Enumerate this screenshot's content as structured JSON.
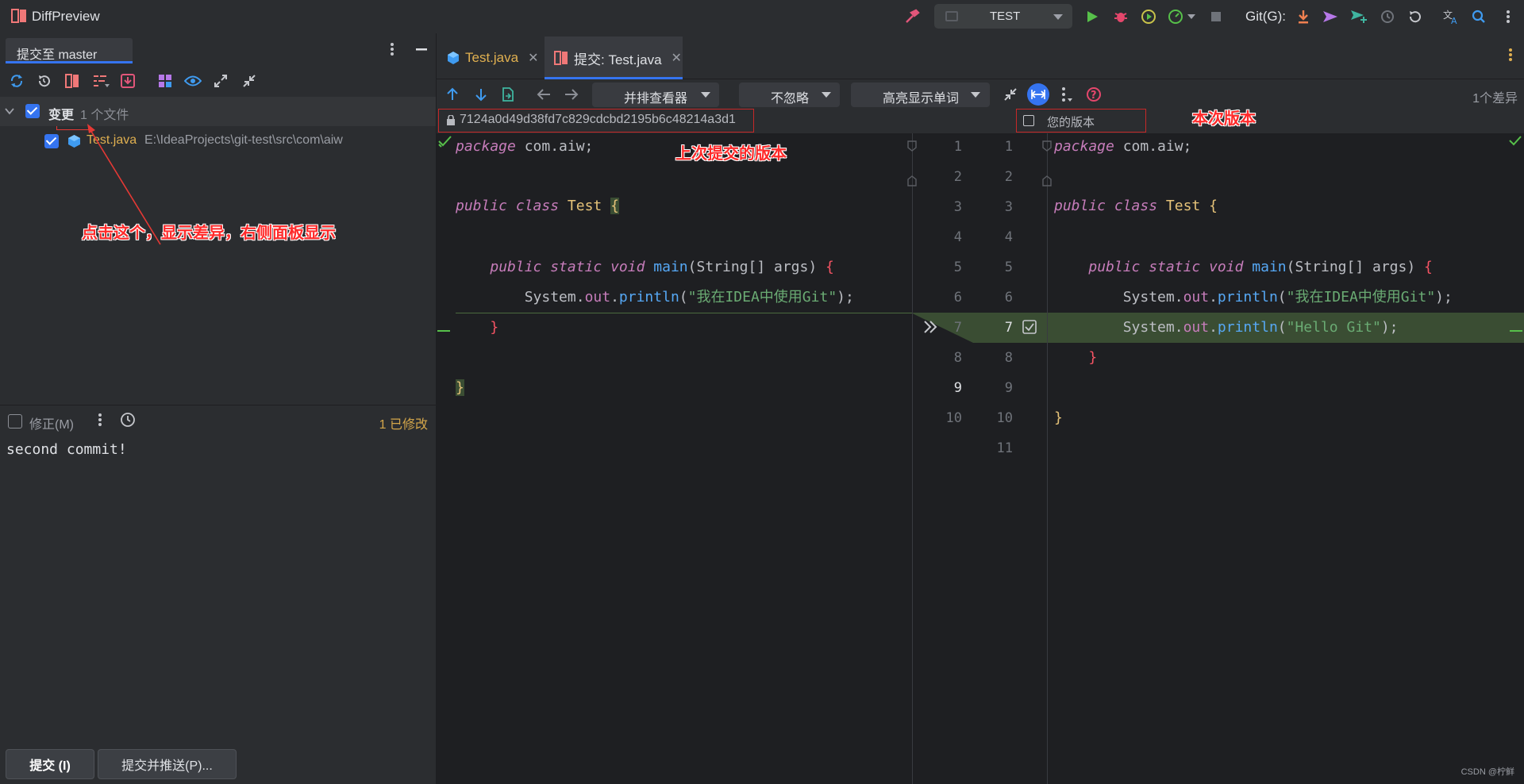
{
  "window": {
    "app_title": "DiffPreview",
    "run_config": "TEST",
    "git_label": "Git(G):"
  },
  "left_panel": {
    "tab_label": "提交至 master",
    "changes_label": "变更",
    "changes_count": "1 个文件",
    "file": {
      "name": "Test.java",
      "path": "E:\\IdeaProjects\\git-test\\src\\com\\aiw"
    },
    "amend_label": "修正(M)",
    "modified_count": "1 已修改",
    "commit_message": "second commit!",
    "commit_button": "提交 (I)",
    "commit_push_button": "提交并推送(P)..."
  },
  "editor_tabs": [
    {
      "label": "Test.java"
    },
    {
      "label": "提交: Test.java"
    }
  ],
  "diff_toolbar": {
    "viewer": "并排查看器",
    "ignore": "不忽略",
    "highlight": "高亮显示单词",
    "diff_count": "1个差异"
  },
  "diff": {
    "left_revision": "7124a0d49d38fd7c829cdcbd2195b6c48214a3d1",
    "right_revision": "您的版本",
    "left_line_numbers": [
      "1",
      "2",
      "3",
      "4",
      "5",
      "6",
      "7",
      "8",
      "9",
      "10"
    ],
    "right_line_numbers": [
      "1",
      "2",
      "3",
      "4",
      "5",
      "6",
      "7",
      "8",
      "9",
      "10",
      "11"
    ],
    "left_code": {
      "l1_kw": "package",
      "l1_rest": " com.aiw;",
      "l3_kw1": "public",
      "l3_kw2": "class",
      "l3_cls": "Test",
      "l3_brace": "{",
      "l5_kw": "public static void",
      "l5_fn": "main",
      "l5_args": "(String[] args) ",
      "l5_brace": "{",
      "l6_sys": "System.",
      "l6_out": "out",
      "l6_dot": ".",
      "l6_fn": "println",
      "l6_str": "\"我在IDEA中使用Git\"",
      "l6_end": ");",
      "l7_brace": "}",
      "l9_brace": "}"
    },
    "right_code": {
      "l7_sys": "System.",
      "l7_out": "out",
      "l7_dot": ".",
      "l7_fn": "println",
      "l7_str": "\"Hello Git\"",
      "l7_end": ");",
      "l8_brace": "}",
      "l10_brace": "}"
    }
  },
  "annotations": {
    "click_hint": "点击这个，显示差异，右侧面板显示",
    "prev_version": "上次提交的版本",
    "this_version": "本次版本"
  },
  "watermark": "CSDN @柠鲜",
  "colors": {
    "accent": "#3574f0",
    "added_line_bg": "#3a4d33",
    "annotation_red": "#ff2a2a"
  }
}
